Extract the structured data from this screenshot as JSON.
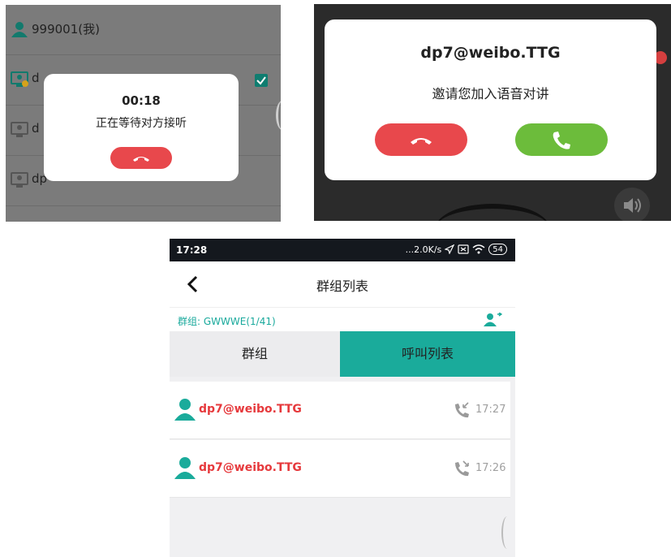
{
  "panel_waiting": {
    "contacts": [
      {
        "label": "999001(我)"
      },
      {
        "label": "d"
      },
      {
        "label": "d"
      },
      {
        "label": "dp"
      }
    ],
    "dialog": {
      "timer": "00:18",
      "status": "正在等待对方接听"
    },
    "colors": {
      "hangup": "#e8484c",
      "checkbox": "#0f7d70"
    }
  },
  "panel_incoming": {
    "dialog": {
      "caller": "dp7@weibo.TTG",
      "message": "邀请您加入语音对讲"
    },
    "colors": {
      "decline": "#e8484c",
      "accept": "#6cbc3b"
    }
  },
  "panel_list": {
    "statusbar": {
      "time": "17:28",
      "network": "...2.0K/s",
      "battery": "54"
    },
    "header": {
      "title": "群组列表"
    },
    "group": {
      "label": "群组: GWWWE(1/41)"
    },
    "tabs": [
      {
        "label": "群组",
        "active": false
      },
      {
        "label": "呼叫列表",
        "active": true
      }
    ],
    "calls": [
      {
        "name": "dp7@weibo.TTG",
        "time": "17:27",
        "icon": "incoming-call-icon"
      },
      {
        "name": "dp7@weibo.TTG",
        "time": "17:26",
        "icon": "missed-call-icon"
      }
    ],
    "colors": {
      "accent": "#1aab9b",
      "name": "#e6393c"
    }
  }
}
